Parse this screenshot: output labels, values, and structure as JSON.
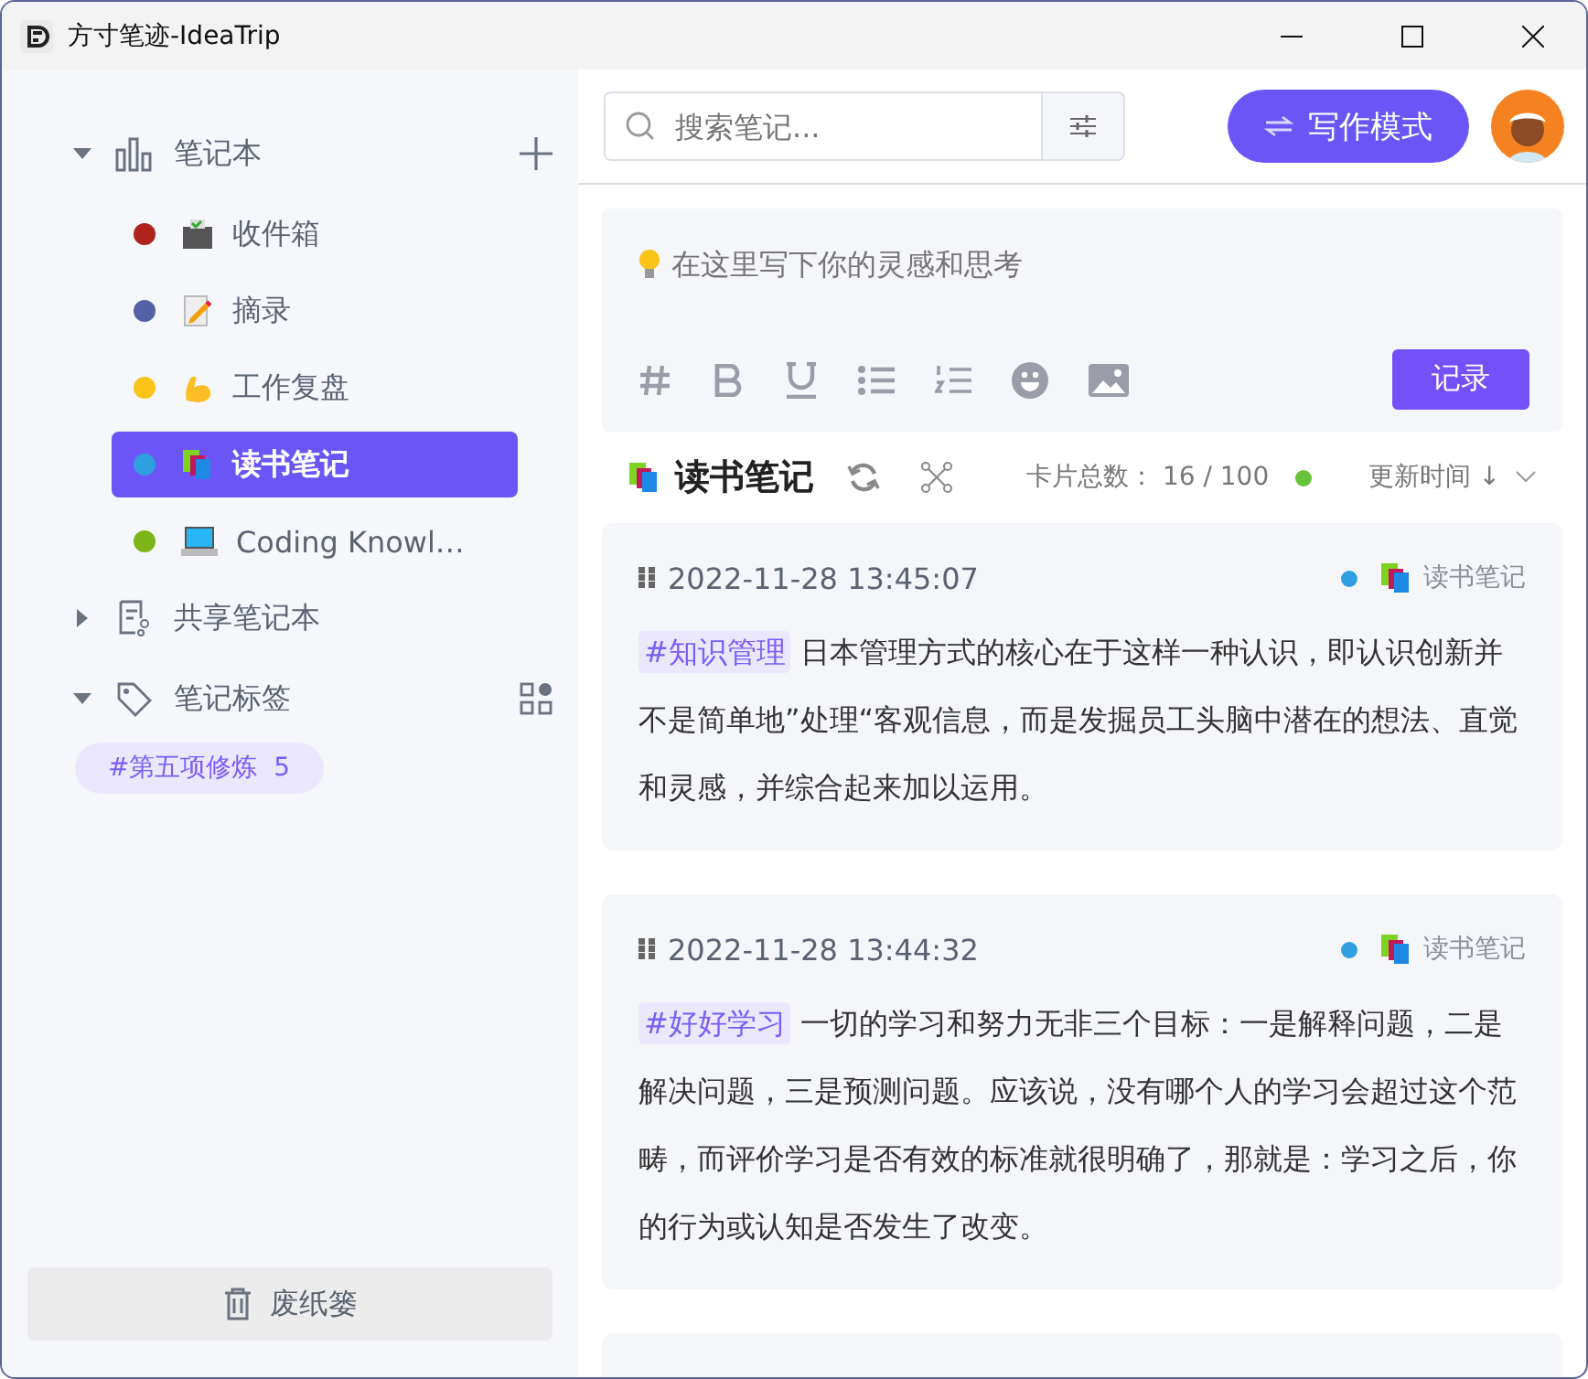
{
  "window": {
    "title": "方寸笔迹-IdeaTrip"
  },
  "sidebar": {
    "notebooks_header": {
      "label": "笔记本",
      "expanded": true
    },
    "notebooks": [
      {
        "name": "收件箱",
        "color": "#b0221c",
        "kind": "inbox",
        "selected": false
      },
      {
        "name": "摘录",
        "color": "#5561a6",
        "kind": "memo",
        "selected": false
      },
      {
        "name": "工作复盘",
        "color": "#fcc419",
        "kind": "muscle",
        "selected": false
      },
      {
        "name": "读书笔记",
        "color": "#2f9fe0",
        "kind": "books",
        "selected": true
      },
      {
        "name": "Coding Knowl…",
        "color": "#7cb518",
        "kind": "laptop",
        "selected": false
      }
    ],
    "shared_header": {
      "label": "共享笔记本",
      "expanded": false
    },
    "tags_header": {
      "label": "笔记标签",
      "expanded": true
    },
    "tags": [
      {
        "label": "#第五项修炼",
        "count": "5"
      }
    ],
    "trash": "废纸篓"
  },
  "search": {
    "placeholder": "搜索笔记..."
  },
  "write_mode_button": "写作模式",
  "editor": {
    "placeholder": "在这里写下你的灵感和思考",
    "submit": "记录"
  },
  "list_header": {
    "title": "读书笔记",
    "count_label": "卡片总数：",
    "count": "16 / 100",
    "sort": "更新时间 ↓"
  },
  "cards": [
    {
      "time": "2022-11-28 13:45:07",
      "notebook": "读书笔记",
      "color": "#2f9fe0",
      "tag": "#知识管理",
      "text": "日本管理方式的核心在于这样一种认识，即认识创新并不是简单地”处理“客观信息，而是发掘员工头脑中潜在的想法、直觉和灵感，并综合起来加以运用。"
    },
    {
      "time": "2022-11-28 13:44:32",
      "notebook": "读书笔记",
      "color": "#2f9fe0",
      "tag": "#好好学习",
      "text": "一切的学习和努力无非三个目标：一是解释问题，二是解决问题，三是预测问题。应该说，没有哪个人的学习会超过这个范畴，而评价学习是否有效的标准就很明确了，那就是：学习之后，你的行为或认知是否发生了改变。"
    }
  ]
}
